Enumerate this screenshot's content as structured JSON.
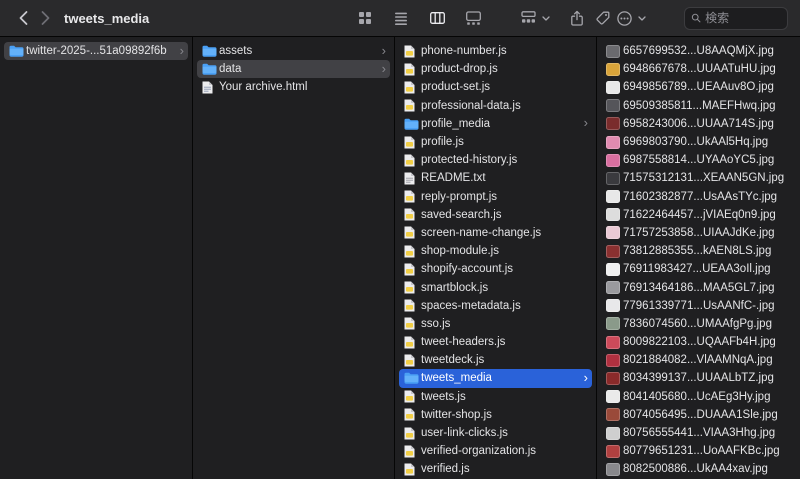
{
  "window": {
    "title": "tweets_media"
  },
  "toolbar": {
    "search_placeholder": "検索",
    "view_modes": [
      "icon-view",
      "list-view",
      "column-view",
      "gallery-view"
    ],
    "active_view": "column-view",
    "buttons": [
      "group-button",
      "share-button",
      "tags-button",
      "more-button"
    ]
  },
  "colors": {
    "accent_blue": "#2a62d9",
    "inactive_selection": "#414145",
    "folder_blue": "#4aa0f5"
  },
  "columns": [
    {
      "name": "column-1",
      "items": [
        {
          "label": "twitter-2025-...51a09892f6b",
          "type": "folder",
          "selected": "inactive",
          "chevron": true
        }
      ]
    },
    {
      "name": "column-2",
      "items": [
        {
          "label": "assets",
          "type": "folder",
          "chevron": true
        },
        {
          "label": "data",
          "type": "folder",
          "selected": "inactive",
          "chevron": true
        },
        {
          "label": "Your archive.html",
          "type": "file-html"
        }
      ]
    },
    {
      "name": "column-3",
      "items": [
        {
          "label": "phone-number.js",
          "type": "file-js"
        },
        {
          "label": "product-drop.js",
          "type": "file-js"
        },
        {
          "label": "product-set.js",
          "type": "file-js"
        },
        {
          "label": "professional-data.js",
          "type": "file-js"
        },
        {
          "label": "profile_media",
          "type": "folder",
          "chevron": true
        },
        {
          "label": "profile.js",
          "type": "file-js"
        },
        {
          "label": "protected-history.js",
          "type": "file-js"
        },
        {
          "label": "README.txt",
          "type": "file-txt"
        },
        {
          "label": "reply-prompt.js",
          "type": "file-js"
        },
        {
          "label": "saved-search.js",
          "type": "file-js"
        },
        {
          "label": "screen-name-change.js",
          "type": "file-js"
        },
        {
          "label": "shop-module.js",
          "type": "file-js"
        },
        {
          "label": "shopify-account.js",
          "type": "file-js"
        },
        {
          "label": "smartblock.js",
          "type": "file-js"
        },
        {
          "label": "spaces-metadata.js",
          "type": "file-js"
        },
        {
          "label": "sso.js",
          "type": "file-js"
        },
        {
          "label": "tweet-headers.js",
          "type": "file-js"
        },
        {
          "label": "tweetdeck.js",
          "type": "file-js"
        },
        {
          "label": "tweets_media",
          "type": "folder",
          "selected": "active",
          "chevron": true
        },
        {
          "label": "tweets.js",
          "type": "file-js"
        },
        {
          "label": "twitter-shop.js",
          "type": "file-js"
        },
        {
          "label": "user-link-clicks.js",
          "type": "file-js"
        },
        {
          "label": "verified-organization.js",
          "type": "file-js"
        },
        {
          "label": "verified.js",
          "type": "file-js"
        }
      ]
    },
    {
      "name": "column-4",
      "items": [
        {
          "label": "6657699532...U8AAQMjX.jpg",
          "type": "image",
          "thumb": "#6a6a6e"
        },
        {
          "label": "6948667678...UUAATuHU.jpg",
          "type": "image",
          "thumb": "#d9a43a"
        },
        {
          "label": "6949856789...UEAAuv8O.jpg",
          "type": "image",
          "thumb": "#e8e8e8"
        },
        {
          "label": "69509385811...MAEFHwq.jpg",
          "type": "image",
          "thumb": "#55555a"
        },
        {
          "label": "6958243006...UUAA714S.jpg",
          "type": "image",
          "thumb": "#7a2c2c"
        },
        {
          "label": "6969803790...UkAAl5Hq.jpg",
          "type": "image",
          "thumb": "#e08bb0"
        },
        {
          "label": "6987558814...UYAAoYC5.jpg",
          "type": "image",
          "thumb": "#d96fa0"
        },
        {
          "label": "71575312131...XEAAN5GN.jpg",
          "type": "image",
          "thumb": "#3a3a3e"
        },
        {
          "label": "71602382877...UsAAsTYc.jpg",
          "type": "image",
          "thumb": "#e8e8e8"
        },
        {
          "label": "71622464457...jVIAEq0n9.jpg",
          "type": "image",
          "thumb": "#dddddd"
        },
        {
          "label": "71757253858...UIAAJdKe.jpg",
          "type": "image",
          "thumb": "#e9c9d4"
        },
        {
          "label": "73812885355...kAEN8LS.jpg",
          "type": "image",
          "thumb": "#8a3030"
        },
        {
          "label": "76911983427...UEAA3oIl.jpg",
          "type": "image",
          "thumb": "#efefef"
        },
        {
          "label": "76913464186...MAA5GL7.jpg",
          "type": "image",
          "thumb": "#9a9a9e"
        },
        {
          "label": "77961339771...UsAANfC-.jpg",
          "type": "image",
          "thumb": "#e8e8ea"
        },
        {
          "label": "7836074560...UMAAfgPg.jpg",
          "type": "image",
          "thumb": "#8a9a8a"
        },
        {
          "label": "8009822103...UQAAFb4H.jpg",
          "type": "image",
          "thumb": "#cc4a5a"
        },
        {
          "label": "8021884082...VlAAMNqA.jpg",
          "type": "image",
          "thumb": "#b03040"
        },
        {
          "label": "8034399137...UUAALbTZ.jpg",
          "type": "image",
          "thumb": "#8a2a2a"
        },
        {
          "label": "8041405680...UcAEg3Hy.jpg",
          "type": "image",
          "thumb": "#eaeaea"
        },
        {
          "label": "8074056495...DUAAA1Sle.jpg",
          "type": "image",
          "thumb": "#9a4a3a"
        },
        {
          "label": "80756555441...VIAA3Hhg.jpg",
          "type": "image",
          "thumb": "#cfcfcf"
        },
        {
          "label": "80779651231...UoAAFKBc.jpg",
          "type": "image",
          "thumb": "#b04040"
        },
        {
          "label": "8082500886...UkAA4xav.jpg",
          "type": "image",
          "thumb": "#88888c"
        }
      ]
    }
  ]
}
